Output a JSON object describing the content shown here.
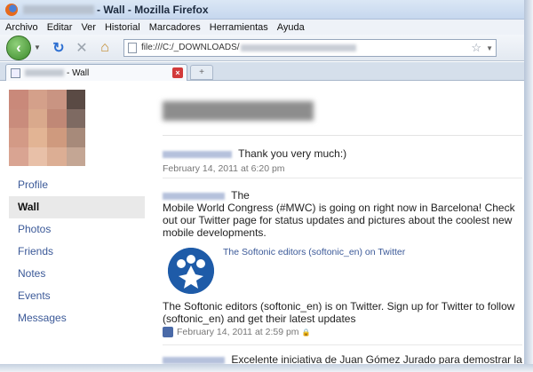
{
  "window": {
    "title": "- Wall - Mozilla Firefox"
  },
  "menu": [
    "Archivo",
    "Editar",
    "Ver",
    "Historial",
    "Marcadores",
    "Herramientas",
    "Ayuda"
  ],
  "url": {
    "prefix": "file:///C:/_DOWNLOADS/"
  },
  "tab": {
    "title": "- Wall",
    "close_glyph": "×",
    "new_tab_glyph": "+"
  },
  "sidebar": {
    "items": [
      {
        "label": "Profile"
      },
      {
        "label": "Wall"
      },
      {
        "label": "Photos"
      },
      {
        "label": "Friends"
      },
      {
        "label": "Notes"
      },
      {
        "label": "Events"
      },
      {
        "label": "Messages"
      }
    ]
  },
  "posts": [
    {
      "text": "Thank you very much:)",
      "date": "February 14, 2011 at 6:20 pm"
    },
    {
      "text": "The",
      "body": "Mobile World Congress (#MWC) is going on right now in Barcelona! Check out our Twitter page for status updates and pictures about the coolest new mobile developments.",
      "attachment_title": "The Softonic editors (softonic_en) on Twitter",
      "attachment_desc": "The Softonic editors (softonic_en) is on Twitter. Sign up for Twitter to follow (softonic_en) and get their latest updates",
      "date": "February 14, 2011 at 2:59 pm"
    },
    {
      "text": "Excelente iniciativa de Juan Gómez Jurado para demostrar la"
    }
  ],
  "colors": {
    "link": "#3b5998",
    "softonic_blue": "#1e5ba8"
  },
  "icons": {
    "back": "back-arrow-icon",
    "reload": "reload-icon",
    "stop": "stop-icon",
    "home": "home-icon",
    "bookmark": "star-icon"
  }
}
